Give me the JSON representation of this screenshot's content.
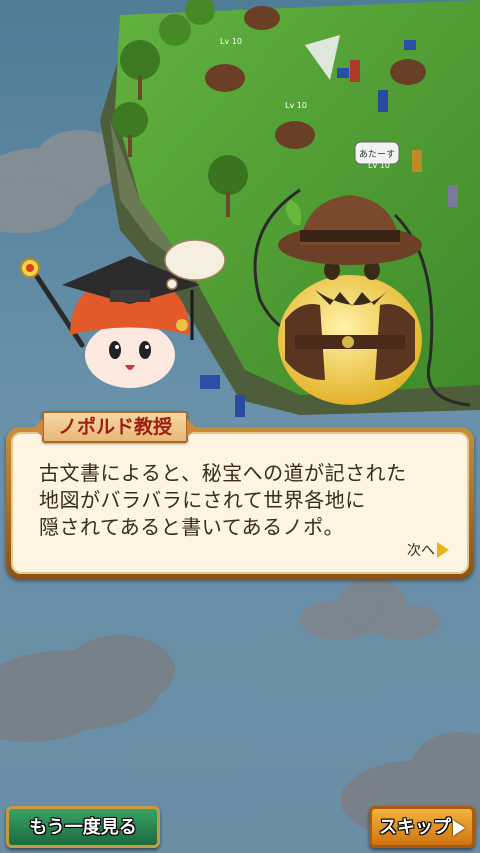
{
  "dialogue": {
    "speaker": "ノポルド教授",
    "text": "古文書によると、秘宝への道が記された\n地図がバラバラにされて世界各地に\n隠されてあると書いてあるノポ。",
    "next_label": "次へ"
  },
  "buttons": {
    "replay_label": "もう一度見る",
    "skip_label": "スキップ"
  },
  "scene": {
    "speech_bubble_text": "あたーす",
    "level_labels": [
      "Lv 10",
      "Lv 10",
      "Lv 10"
    ]
  },
  "colors": {
    "sky": "#5e88a2",
    "grass": "#4f9a33",
    "dialogue_border": "#b67a30",
    "dialogue_bg": "#fdf5e1",
    "speaker_text": "#9c1e10",
    "replay_button": "#268348",
    "skip_button": "#e8961f"
  }
}
